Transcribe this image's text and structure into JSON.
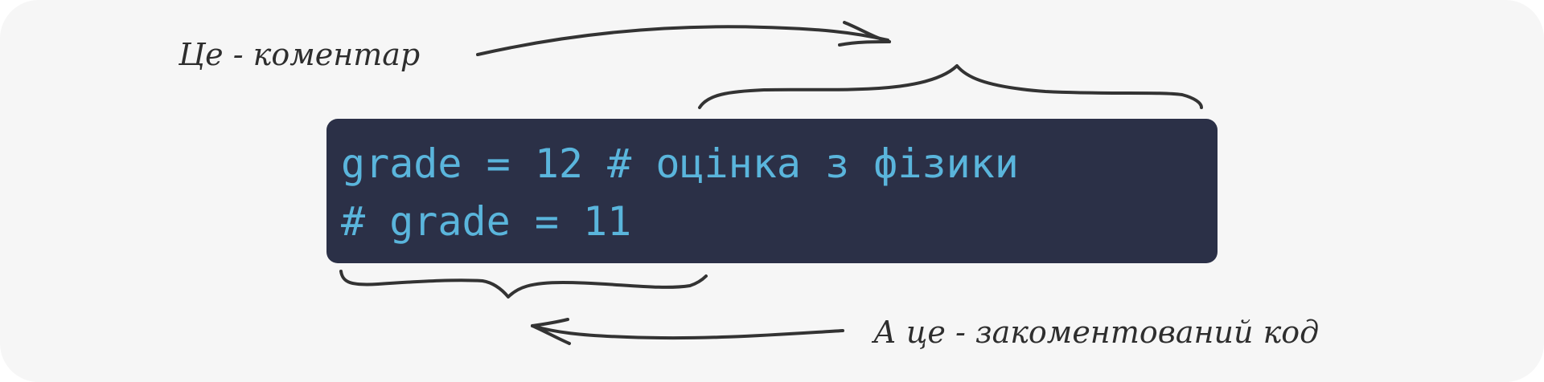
{
  "code": {
    "lines": [
      "grade = 12 # оцінка з фізики",
      "# grade = 11"
    ]
  },
  "annotations": {
    "comment_note": "Це - коментар",
    "commented_code_note": "А це - закоментований код"
  },
  "colors": {
    "background": "#f6f6f6",
    "code_background": "#2b3047",
    "code_text": "#5ab5dc",
    "ink": "#333333"
  },
  "icons": {
    "top_arrow": "arrow-right-icon",
    "bottom_arrow": "arrow-left-icon",
    "top_brace": "curly-brace-down-icon",
    "bottom_brace": "curly-brace-up-icon"
  }
}
